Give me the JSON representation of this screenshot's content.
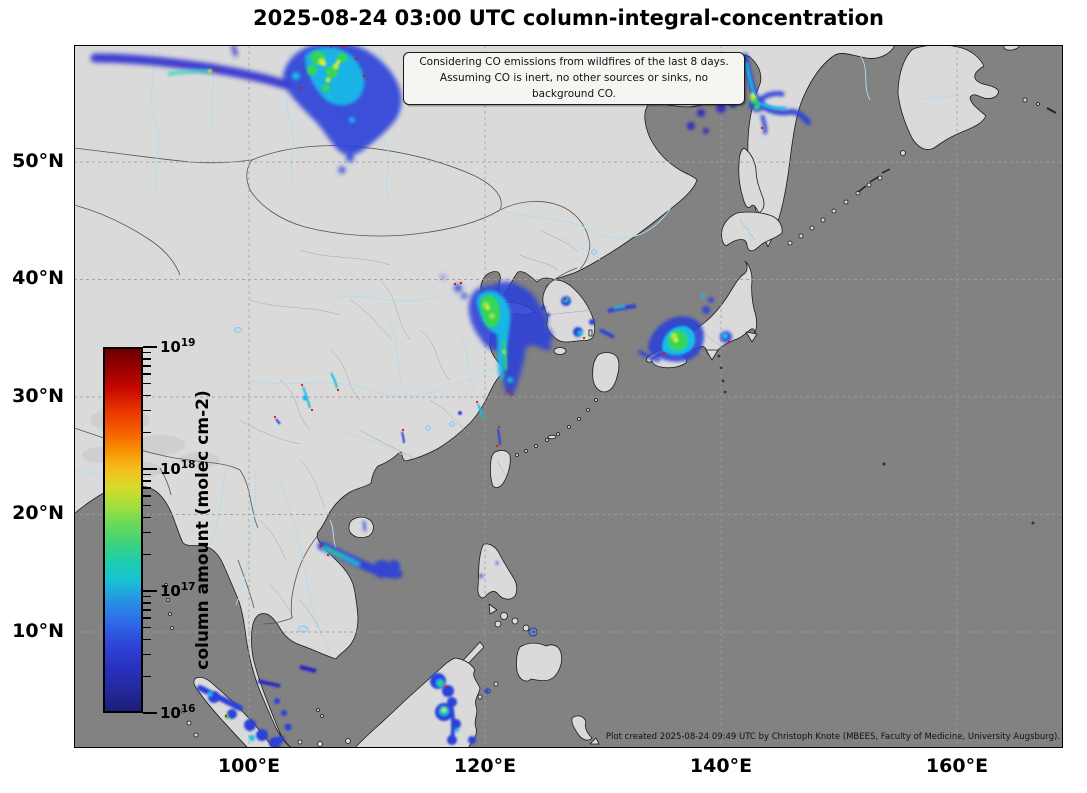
{
  "title": "2025-08-24 03:00 UTC column-integral-concentration",
  "annotation": {
    "line1": "Considering CO emissions from wildfires of the last 8 days.",
    "line2": "Assuming CO is inert, no other sources or sinks, no background CO."
  },
  "axes": {
    "lat_ticks": [
      {
        "text": "50°N"
      },
      {
        "text": "40°N"
      },
      {
        "text": "30°N"
      },
      {
        "text": "20°N"
      },
      {
        "text": "10°N"
      }
    ],
    "lon_ticks": [
      {
        "text": "100°E"
      },
      {
        "text": "120°E"
      },
      {
        "text": "140°E"
      },
      {
        "text": "160°E"
      }
    ]
  },
  "colorbar": {
    "label": "column amount (molec cm-2)",
    "scale": "log",
    "ticks": [
      {
        "base": "10",
        "exp": "19"
      },
      {
        "base": "10",
        "exp": "18"
      },
      {
        "base": "10",
        "exp": "17"
      },
      {
        "base": "10",
        "exp": "16"
      }
    ]
  },
  "credit": "Plot created 2025-08-24 09:49 UTC by Christoph Knote (MBEES, Faculty of Medicine, University Augsburg).",
  "colors": {
    "ocean": "#828282",
    "land": "#dadada",
    "coastline": "#1a1a1a",
    "river": "#b5daf3",
    "graticule": "#9e9e9e",
    "annotation_bg": "#f5f5f2",
    "fire_spot": "#e01500",
    "plume_blue": "#2b3fd8",
    "plume_cyan": "#16bce8",
    "plume_green": "#35d655",
    "plume_yellow": "#eeee35"
  },
  "chart_data": {
    "type": "heatmap",
    "title": "2025-08-24 03:00 UTC column-integral-concentration",
    "variable": "CO column amount (molec cm-2)",
    "scale": "log10",
    "range": [
      "1e16",
      "1e19"
    ],
    "map_extent": {
      "lon": [
        86,
        169
      ],
      "lat": [
        0,
        60
      ]
    },
    "graticule": {
      "lat_deg": [
        10,
        20,
        30,
        40,
        50
      ],
      "lon_deg": [
        100,
        120,
        140,
        160
      ]
    },
    "plumes": [
      {
        "area": "northern Siberia",
        "approx_lon": 106,
        "approx_lat": 57,
        "peak": "~1e18"
      },
      {
        "area": "west Siberia band",
        "approx_lon": 96,
        "approx_lat": 58,
        "peak": "~1e17"
      },
      {
        "area": "Magadan coast west of Kamchatka",
        "approx_lon": 138,
        "approx_lat": 55,
        "peak": "~5e16"
      },
      {
        "area": "northern Kamchatka",
        "approx_lon": 143,
        "approx_lat": 55,
        "peak": "~7e17"
      },
      {
        "area": "eastern China / Yellow Sea",
        "approx_lon": 120,
        "approx_lat": 34,
        "peak": "~6e17"
      },
      {
        "area": "Korea / Korea Strait",
        "approx_lon": 127,
        "approx_lat": 36,
        "peak": "~1e17"
      },
      {
        "area": "central Japan (Nagoya/Osaka)",
        "approx_lon": 136,
        "approx_lat": 35,
        "peak": "~7e17"
      },
      {
        "area": "Tokyo bay",
        "approx_lon": 140.5,
        "approx_lat": 35.5,
        "peak": "~2e17"
      },
      {
        "area": "Vietnam coast",
        "approx_lon": 108,
        "approx_lat": 16.5,
        "peak": "~2e17"
      },
      {
        "area": "scattered southeast China",
        "approx_lon": 110,
        "approx_lat": 28,
        "peak": "~1e17"
      },
      {
        "area": "northern Sumatra / Malacca",
        "approx_lon": 97,
        "approx_lat": 3,
        "peak": "~2e17"
      },
      {
        "area": "Borneo (Sabah)",
        "approx_lon": 116,
        "approx_lat": 3,
        "peak": "~8e17"
      }
    ]
  }
}
